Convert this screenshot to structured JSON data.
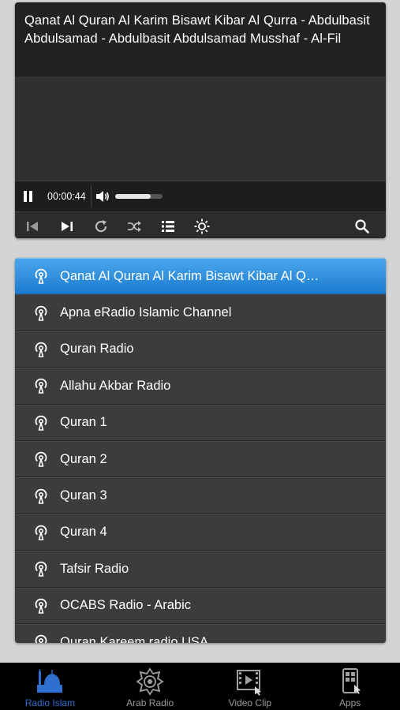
{
  "player": {
    "now_playing": "Qanat Al Quran Al Karim Bisawt Kibar Al Qurra - Abdulbasit Abdulsamad - Abdulbasit Abdulsamad Musshaf - Al-Fil",
    "elapsed": "00:00:44",
    "volume": 0.75
  },
  "stations": [
    {
      "label": "Qanat Al Quran Al Karim Bisawt Kibar Al Qurra - Abdulbasit Abdulsamad",
      "selected": true
    },
    {
      "label": "Apna eRadio Islamic Channel"
    },
    {
      "label": "Quran Radio"
    },
    {
      "label": "Allahu Akbar Radio"
    },
    {
      "label": "Quran 1"
    },
    {
      "label": "Quran 2"
    },
    {
      "label": "Quran 3"
    },
    {
      "label": "Quran 4"
    },
    {
      "label": "Tafsir Radio"
    },
    {
      "label": "OCABS Radio - Arabic"
    },
    {
      "label": "Quran Kareem radio USA"
    }
  ],
  "tabs": [
    {
      "label": "Radio Islam",
      "icon": "mosque-icon",
      "active": true
    },
    {
      "label": "Arab Radio",
      "icon": "ornament-icon"
    },
    {
      "label": "Video Clip",
      "icon": "video-clip-icon"
    },
    {
      "label": "Apps",
      "icon": "apps-phone-icon"
    }
  ],
  "colors": {
    "selected_row": "#2b8be0",
    "active_tab": "#2f6fd0"
  }
}
